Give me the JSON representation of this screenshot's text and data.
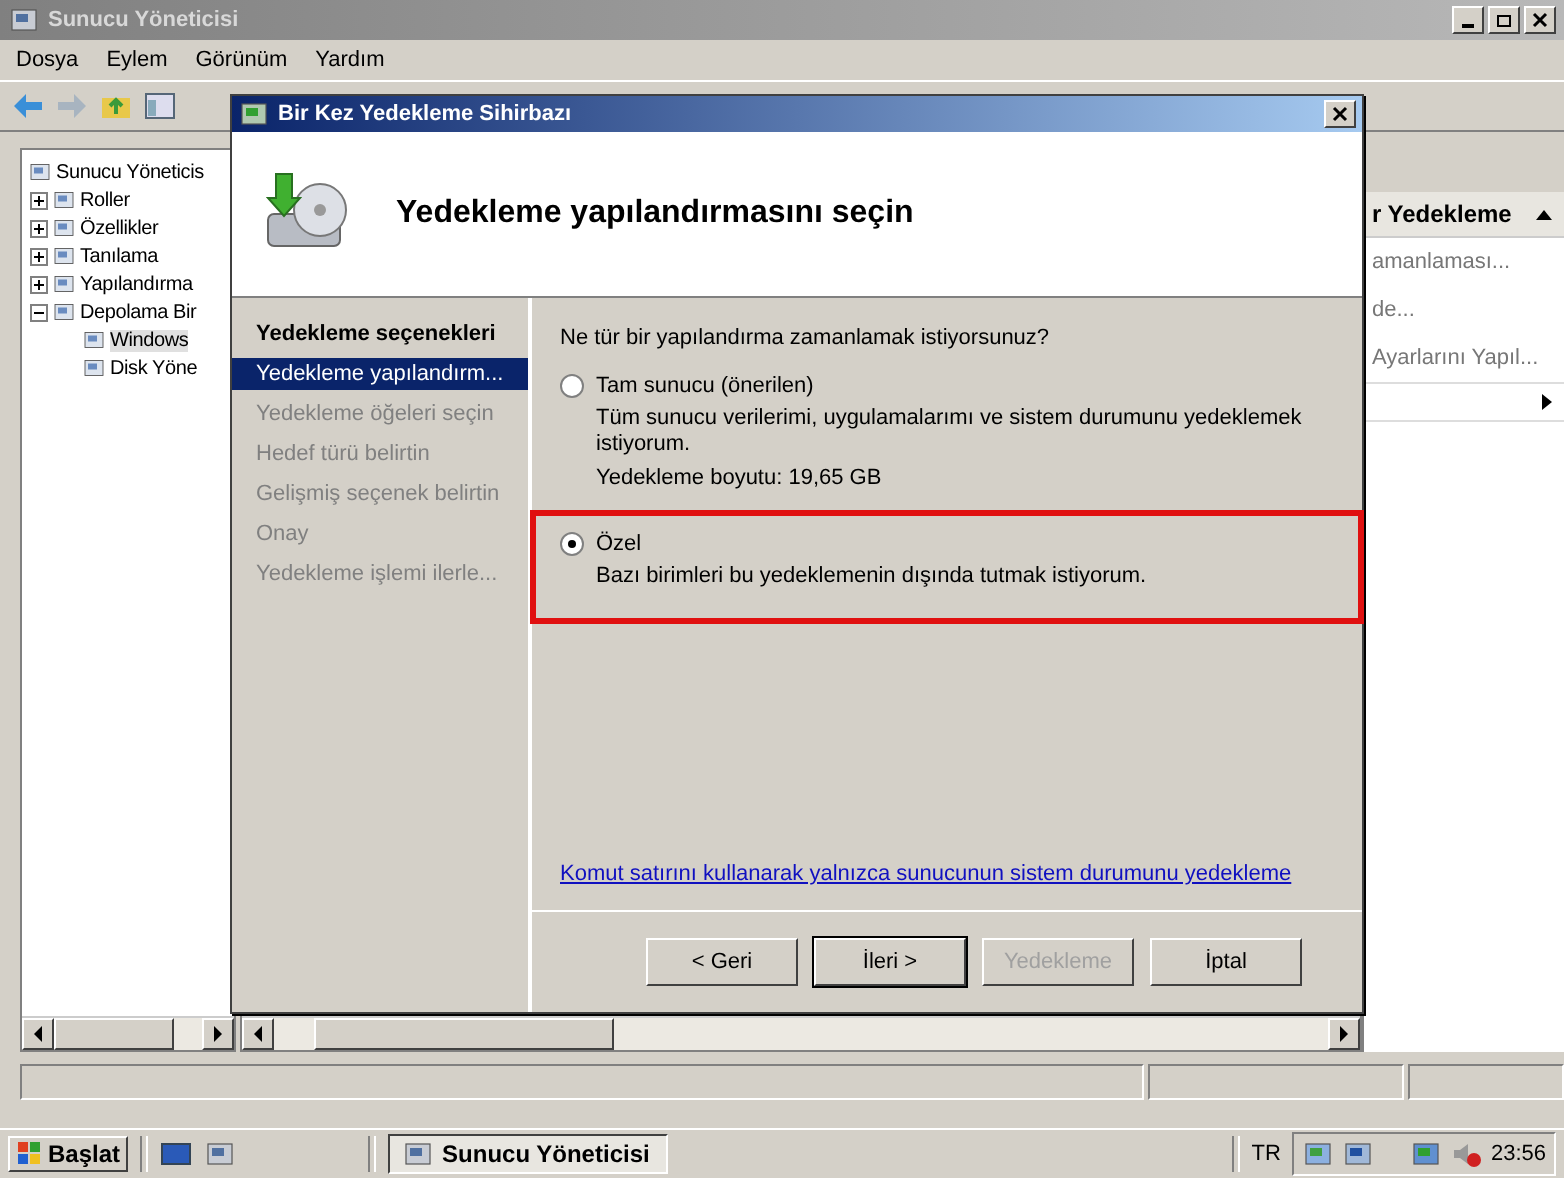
{
  "window": {
    "title": "Sunucu Yöneticisi"
  },
  "menu": [
    "Dosya",
    "Eylem",
    "Görünüm",
    "Yardım"
  ],
  "tree": [
    {
      "label": "Sunucu Yöneticis",
      "selected": false,
      "children": [
        {
          "label": "Roller",
          "expanded": false,
          "selected": false
        },
        {
          "label": "Özellikler",
          "expanded": false,
          "selected": false
        },
        {
          "label": "Tanılama",
          "expanded": false,
          "selected": false
        },
        {
          "label": "Yapılandırma",
          "expanded": false,
          "selected": false
        },
        {
          "label": "Depolama Bir",
          "expanded": true,
          "selected": false,
          "children": [
            {
              "label": "Windows",
              "selected": true
            },
            {
              "label": "Disk Yöne",
              "selected": false
            }
          ]
        }
      ]
    }
  ],
  "actions": {
    "header": "r Yedekleme",
    "items": [
      {
        "label": "amanlaması..."
      },
      {
        "label": "de..."
      },
      {
        "label": "Ayarlarını Yapıl..."
      }
    ]
  },
  "dialog": {
    "title": "Bir Kez Yedekleme Sihirbazı",
    "heading": "Yedekleme yapılandırmasını seçin",
    "steps": [
      {
        "label": "Yedekleme seçenekleri",
        "selected": false,
        "disabled": false
      },
      {
        "label": "Yedekleme yapılandırm...",
        "selected": true,
        "disabled": false
      },
      {
        "label": "Yedekleme öğeleri seçin",
        "selected": false,
        "disabled": true
      },
      {
        "label": "Hedef türü belirtin",
        "selected": false,
        "disabled": true
      },
      {
        "label": "Gelişmiş seçenek belirtin",
        "selected": false,
        "disabled": true
      },
      {
        "label": "Onay",
        "selected": false,
        "disabled": true
      },
      {
        "label": "Yedekleme işlemi ilerle...",
        "selected": false,
        "disabled": true
      }
    ],
    "question": "Ne tür bir yapılandırma zamanlamak istiyorsunuz?",
    "options": [
      {
        "label": "Tam sunucu (önerilen)",
        "description": "Tüm sunucu verilerimi, uygulamalarımı ve sistem durumunu yedeklemek istiyorum.",
        "size": "Yedekleme boyutu: 19,65 GB",
        "selected": false,
        "highlighted": false
      },
      {
        "label": "Özel",
        "description": "Bazı birimleri bu yedeklemenin dışında tutmak istiyorum.",
        "selected": true,
        "highlighted": true
      }
    ],
    "link": "Komut satırını kullanarak yalnızca sunucunun sistem durumunu yedekleme",
    "buttons": [
      {
        "label": "< Geri",
        "disabled": false,
        "default": false
      },
      {
        "label": "İleri >",
        "disabled": false,
        "default": true
      },
      {
        "label": "Yedekleme",
        "disabled": true,
        "default": false
      },
      {
        "label": "İptal",
        "disabled": false,
        "default": false
      }
    ]
  },
  "taskbar": {
    "start": "Başlat",
    "task": "Sunucu Yöneticisi",
    "language": "TR",
    "time": "23:56"
  }
}
